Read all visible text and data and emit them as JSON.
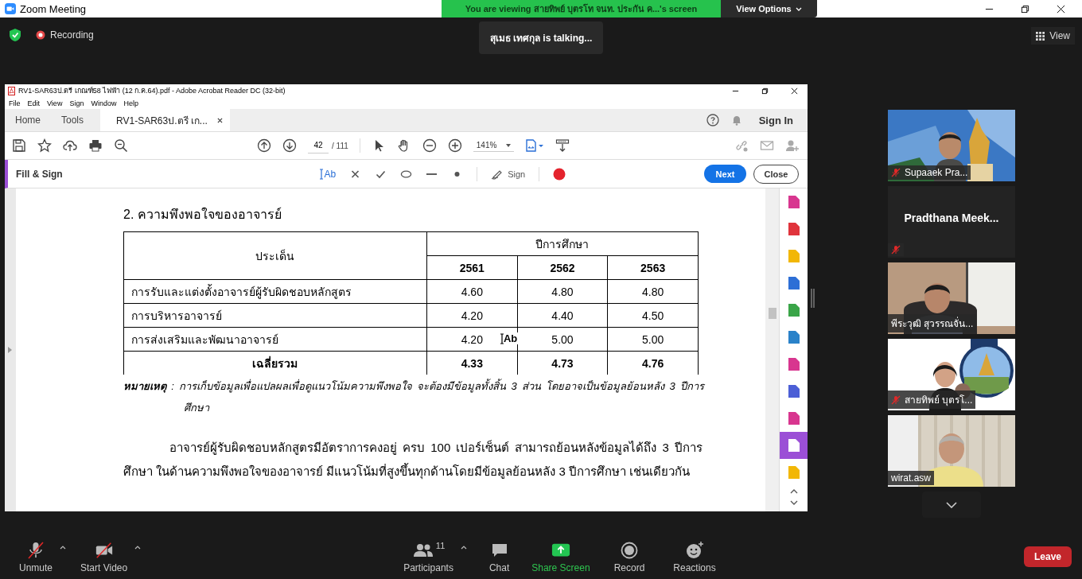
{
  "window": {
    "title": "Zoom Meeting"
  },
  "share_banner": {
    "text": "You are viewing สายทิพย์  บุตรโท จนท. ประกัน ค...'s screen",
    "options": "View Options"
  },
  "recording": {
    "label": "Recording"
  },
  "talking": "สุเมธ เทศกุล is  talking...",
  "view_button": "View",
  "acrobat": {
    "title": "RV1-SAR63ป.ตรี เกณฑ์58 ไฟฟ้า (12 ก.ค.64).pdf - Adobe Acrobat Reader DC (32-bit)",
    "menu": [
      "File",
      "Edit",
      "View",
      "Sign",
      "Window",
      "Help"
    ],
    "tabs": [
      {
        "label": "Home",
        "selected": false
      },
      {
        "label": "Tools",
        "selected": false
      },
      {
        "label": "RV1-SAR63ป.ตรี เก...",
        "selected": true
      }
    ],
    "sign_in": "Sign In",
    "page_current": "42",
    "page_total": "/ 111",
    "zoom": "141%",
    "fill_sign": {
      "title": "Fill & Sign",
      "text_tool": "Ab",
      "sign": "Sign",
      "next": "Next",
      "close": "Close"
    },
    "right_tools": [
      {
        "color": "#d8368f",
        "selected": false
      },
      {
        "color": "#e0343c",
        "selected": false
      },
      {
        "color": "#f2b705",
        "selected": false
      },
      {
        "color": "#2d6fd6",
        "selected": false
      },
      {
        "color": "#3aa548",
        "selected": false
      },
      {
        "color": "#2a82c9",
        "selected": false
      },
      {
        "color": "#d8368f",
        "selected": false
      },
      {
        "color": "#4c5fd6",
        "selected": false
      },
      {
        "color": "#d8368f",
        "selected": false
      },
      {
        "color": "#ffffff",
        "selected": true
      },
      {
        "color": "#f2b705",
        "selected": false
      }
    ],
    "document": {
      "heading": "2.  ความพึงพอใจของอาจารย์",
      "table": {
        "topic": "ประเด็น",
        "group": "ปีการศึกษา",
        "years": [
          "2561",
          "2562",
          "2563"
        ],
        "rows": [
          {
            "kind": "data",
            "label": "การรับและแต่งตั้งอาจารย์ผู้รับผิดชอบหลักสูตร",
            "values": [
              "4.60",
              "4.80",
              "4.80"
            ]
          },
          {
            "kind": "data",
            "label": "การบริหารอาจารย์",
            "values": [
              "4.20",
              "4.40",
              "4.50"
            ]
          },
          {
            "kind": "data",
            "label": "การส่งเสริมและพัฒนาอาจารย์",
            "values": [
              "4.20",
              "5.00",
              "5.00"
            ]
          },
          {
            "kind": "total",
            "label": "เฉลี่ยรวม",
            "values": [
              "4.33",
              "4.73",
              "4.76"
            ]
          }
        ]
      },
      "cursor_label": "Ab",
      "note_label": "หมายเหตุ",
      "note_text": ": การเก็บข้อมูลเพื่อแปลผลเพื่อดูแนวโน้มความพึงพอใจ  จะต้องมีข้อมูลทั้งสิ้น 3 ส่วน โดยอาจเป็นข้อมูลย้อนหลัง 3 ปีการศึกษา",
      "paragraph": "อาจารย์ผู้รับผิดชอบหลักสูตรมีอัตราการคงอยู่ ครบ 100 เปอร์เซ็นต์ สามารถย้อนหลังข้อมูลได้ถึง 3 ปีการศึกษา ในด้านความพึงพอใจของอาจารย์ มีแนวโน้มที่สูงขึ้นทุกด้านโดยมีข้อมูลย้อนหลัง 3 ปีการศึกษา เช่นเดียวกัน"
    }
  },
  "participants": [
    {
      "kind": "video",
      "name": "Supaaek Pra...",
      "muted": true
    },
    {
      "kind": "name_only",
      "name": "Pradthana  Meek...",
      "muted": true
    },
    {
      "kind": "video",
      "name": "พีระวุฒิ สุวรรณจั่น...",
      "muted": false
    },
    {
      "kind": "video",
      "name": "สายทิพย์  บุตรโ...",
      "muted": true
    },
    {
      "kind": "video",
      "name": "wirat.asw",
      "muted": false
    }
  ],
  "toolbar": [
    {
      "kind": "audio",
      "label": "Unmute"
    },
    {
      "kind": "video",
      "label": "Start Video"
    },
    {
      "kind": "participants",
      "label": "Participants",
      "count": "11"
    },
    {
      "kind": "chat",
      "label": "Chat"
    },
    {
      "kind": "share",
      "label": "Share Screen"
    },
    {
      "kind": "record",
      "label": "Record"
    },
    {
      "kind": "reactions",
      "label": "Reactions"
    }
  ],
  "leave": "Leave"
}
